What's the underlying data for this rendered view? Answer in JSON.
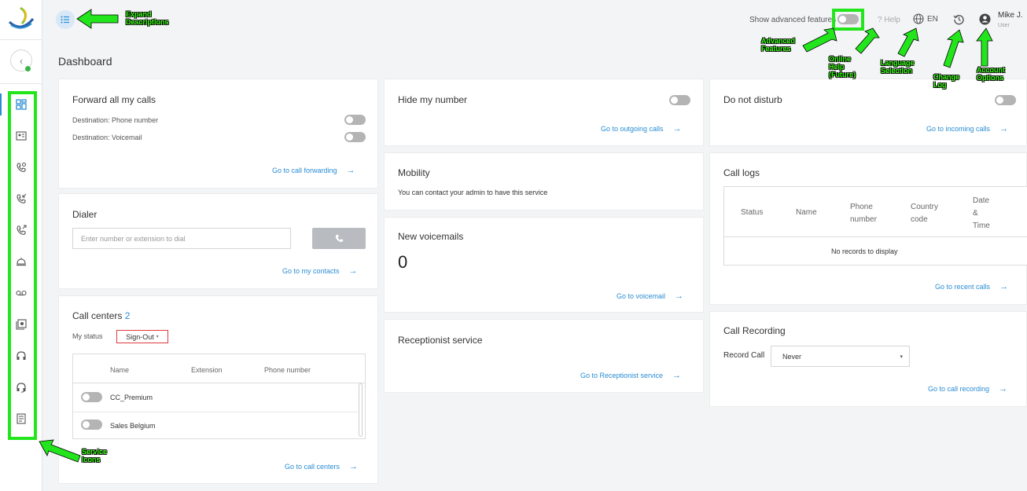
{
  "header": {
    "advanced_label": "Show advanced features",
    "help_label": "Help",
    "lang_label": "EN",
    "user_name": "Mike J.",
    "user_role": "User"
  },
  "page": {
    "title": "Dashboard"
  },
  "sidebar": {
    "items": [
      "dashboard-icon",
      "contact-card-icon",
      "phone-settings-icon",
      "incoming-call-icon",
      "outgoing-call-icon",
      "desk-bell-icon",
      "voicemail-icon",
      "recordings-icon",
      "headset-icon",
      "headset-agent-icon",
      "log-icon"
    ]
  },
  "forward": {
    "title": "Forward all my calls",
    "dest_phone": "Destination: Phone number",
    "dest_voicemail": "Destination: Voicemail",
    "link": "Go to call forwarding"
  },
  "dialer": {
    "title": "Dialer",
    "placeholder": "Enter number or extension to dial",
    "link": "Go to my contacts"
  },
  "callcenters": {
    "title": "Call centers",
    "count": "2",
    "status_label": "My status",
    "status_value": "Sign-Out",
    "columns": [
      "Name",
      "Extension",
      "Phone number"
    ],
    "rows": [
      "CC_Premium",
      "Sales Belgium"
    ],
    "link": "Go to call centers"
  },
  "hide": {
    "title": "Hide my number",
    "link": "Go to outgoing calls"
  },
  "mobility": {
    "title": "Mobility",
    "text": "You can contact your admin to have this service"
  },
  "voicemails": {
    "title": "New voicemails",
    "count": "0",
    "link": "Go to voicemail"
  },
  "receptionist": {
    "title": "Receptionist service",
    "link": "Go to Receptionist service"
  },
  "dnd": {
    "title": "Do not disturb",
    "link": "Go to incoming calls"
  },
  "calllogs": {
    "title": "Call logs",
    "columns": [
      "Status",
      "Name",
      "Phone number",
      "Country code",
      "Date & Time"
    ],
    "empty": "No records to display",
    "link": "Go to recent calls"
  },
  "recording": {
    "title": "Call Recording",
    "label": "Record Call",
    "value": "Never",
    "link": "Go to call recording"
  },
  "annotations": {
    "expand": "Expand Descriptions",
    "advanced": "Advanced Features",
    "help": "Online Help (Future)",
    "language": "Language Selection",
    "changelog": "Change Log",
    "account": "Account Options",
    "service": "Service Icons"
  },
  "colors": {
    "accent": "#2a8dd4",
    "annotation": "#39ff14",
    "toggle_off": "#b4b4b4"
  }
}
